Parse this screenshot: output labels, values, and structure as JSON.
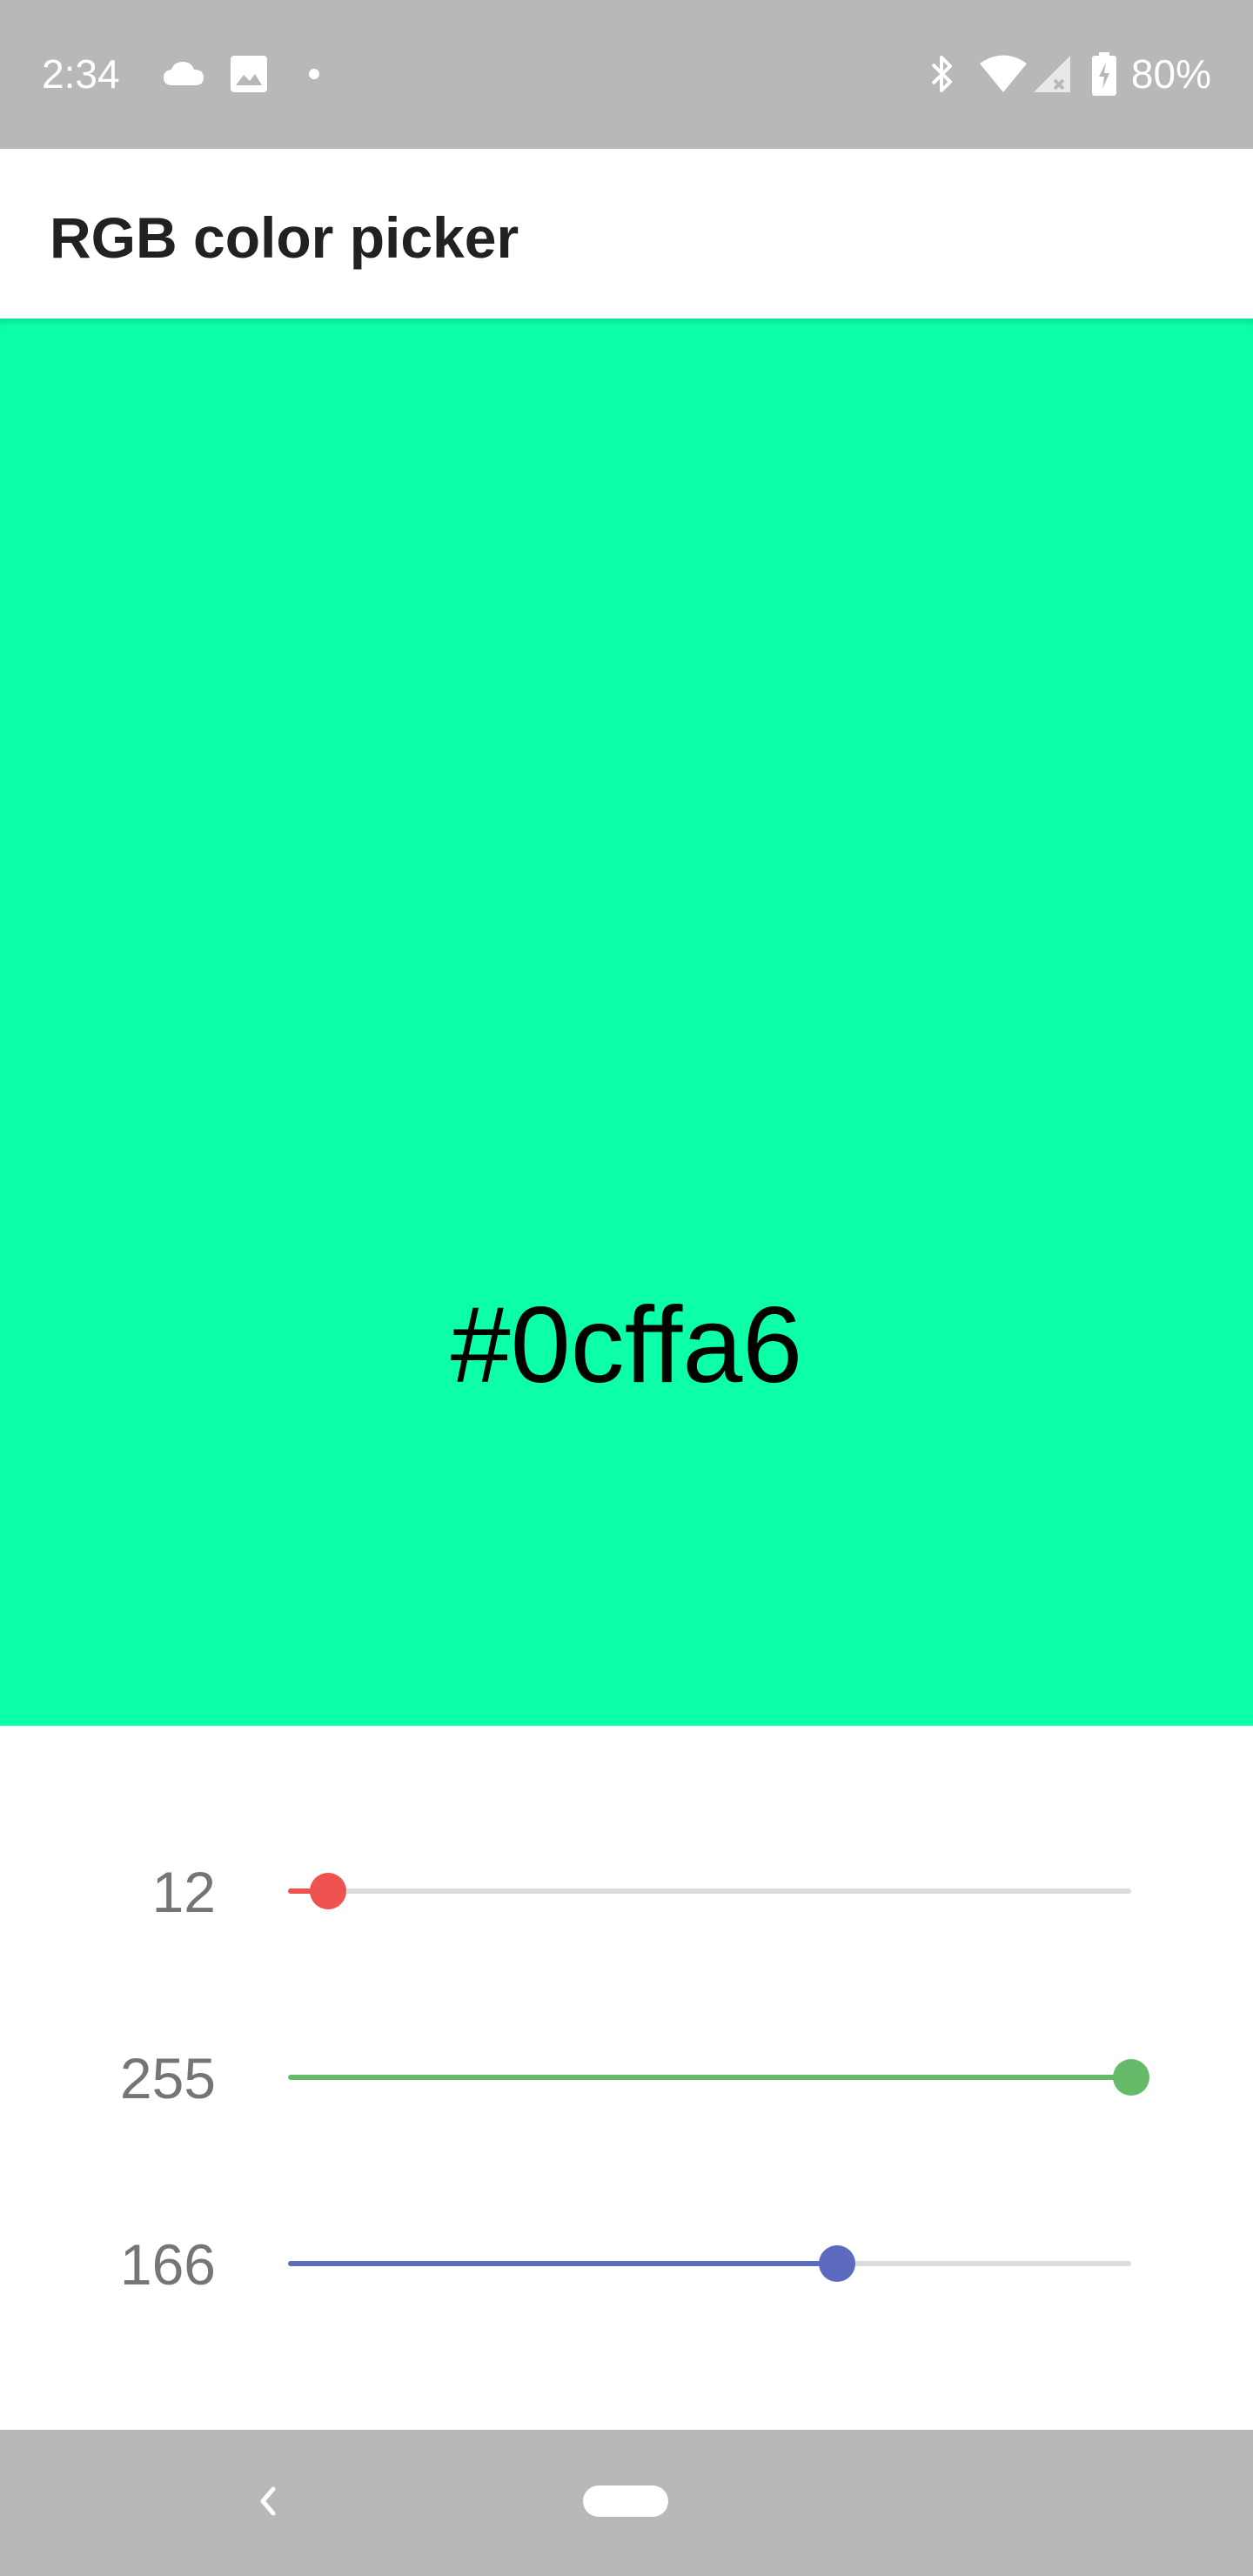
{
  "status_bar": {
    "time": "2:34",
    "battery": "80%",
    "left_icons": [
      "cloud-icon",
      "image-icon",
      "dot-icon"
    ],
    "right_icons": [
      "bluetooth-icon",
      "wifi-icon",
      "signal-icon",
      "battery-icon"
    ]
  },
  "app_bar": {
    "title": "RGB color picker"
  },
  "preview": {
    "hex": "#0cffa6",
    "color": "#0cffa6"
  },
  "sliders": [
    {
      "channel": "red",
      "value": "12",
      "max": 255,
      "color": "#ef5350"
    },
    {
      "channel": "green",
      "value": "255",
      "max": 255,
      "color": "#66bb6a"
    },
    {
      "channel": "blue",
      "value": "166",
      "max": 255,
      "color": "#5c6bc0"
    }
  ],
  "nav_bar": {
    "icons": [
      "back-icon",
      "home-pill"
    ]
  }
}
